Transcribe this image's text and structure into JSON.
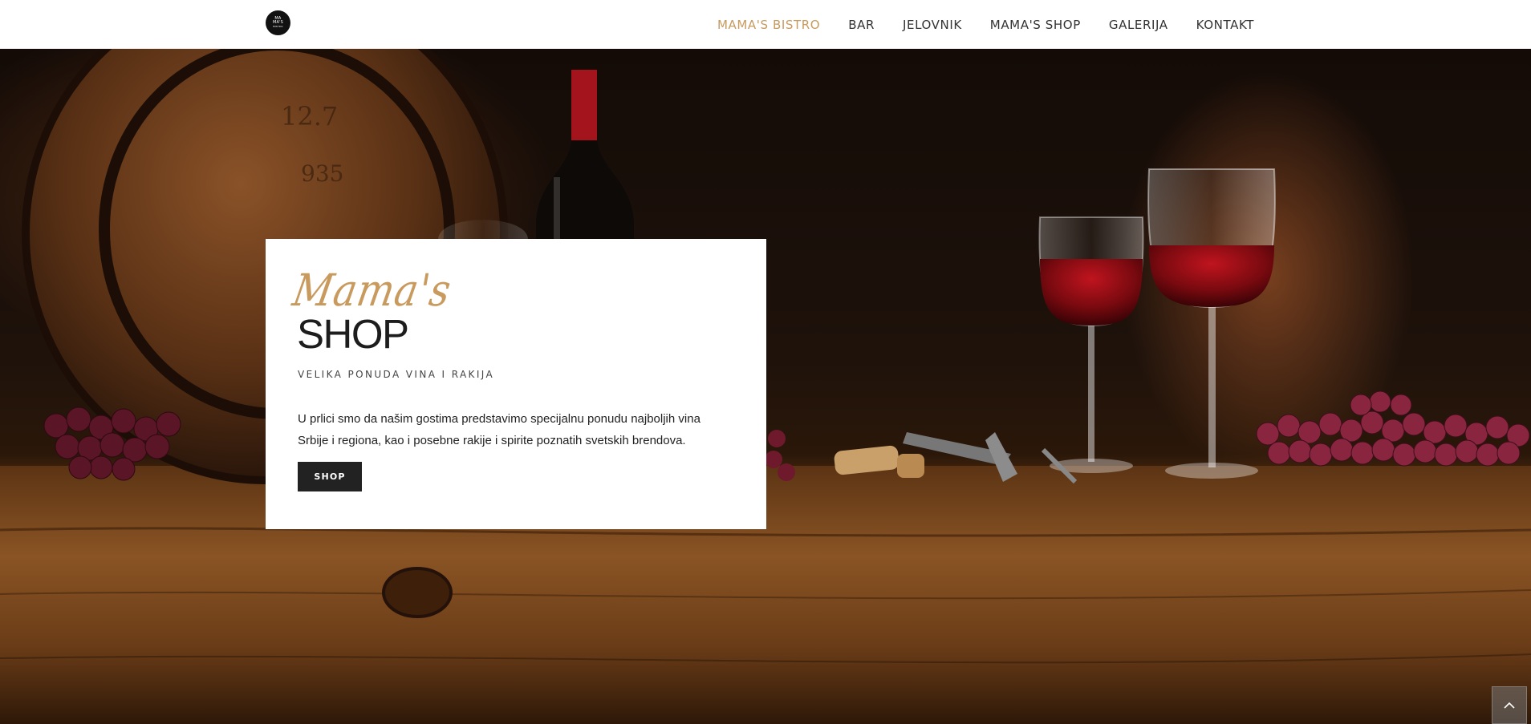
{
  "logo": {
    "lines": [
      "MA",
      "MA'S",
      "BISTRO"
    ]
  },
  "nav": {
    "items": [
      {
        "label": "MAMA'S BISTRO",
        "active": true
      },
      {
        "label": "BAR",
        "active": false
      },
      {
        "label": "JELOVNIK",
        "active": false
      },
      {
        "label": "MAMA'S SHOP",
        "active": false
      },
      {
        "label": "GALERIJA",
        "active": false
      },
      {
        "label": "KONTAKT",
        "active": false
      }
    ]
  },
  "hero": {
    "image": "wine-barrel-bottle-glasses-grapes-photo"
  },
  "promo": {
    "script": "Mama's",
    "title": "SHOP",
    "subtitle": "VELIKA PONUDA VINA I RAKIJA",
    "body": "U prlici smo da našim gostima predstavimo specijalnu ponudu najboljih vina Srbije i regiona, kao i posebne rakije i spirite poznatih svetskih brendova.",
    "button_label": "SHOP"
  },
  "scroll_top": {
    "icon": "chevron-up-icon"
  },
  "colors": {
    "accent": "#c89a5e",
    "button_bg": "#222222",
    "header_bg": "#ffffff"
  }
}
